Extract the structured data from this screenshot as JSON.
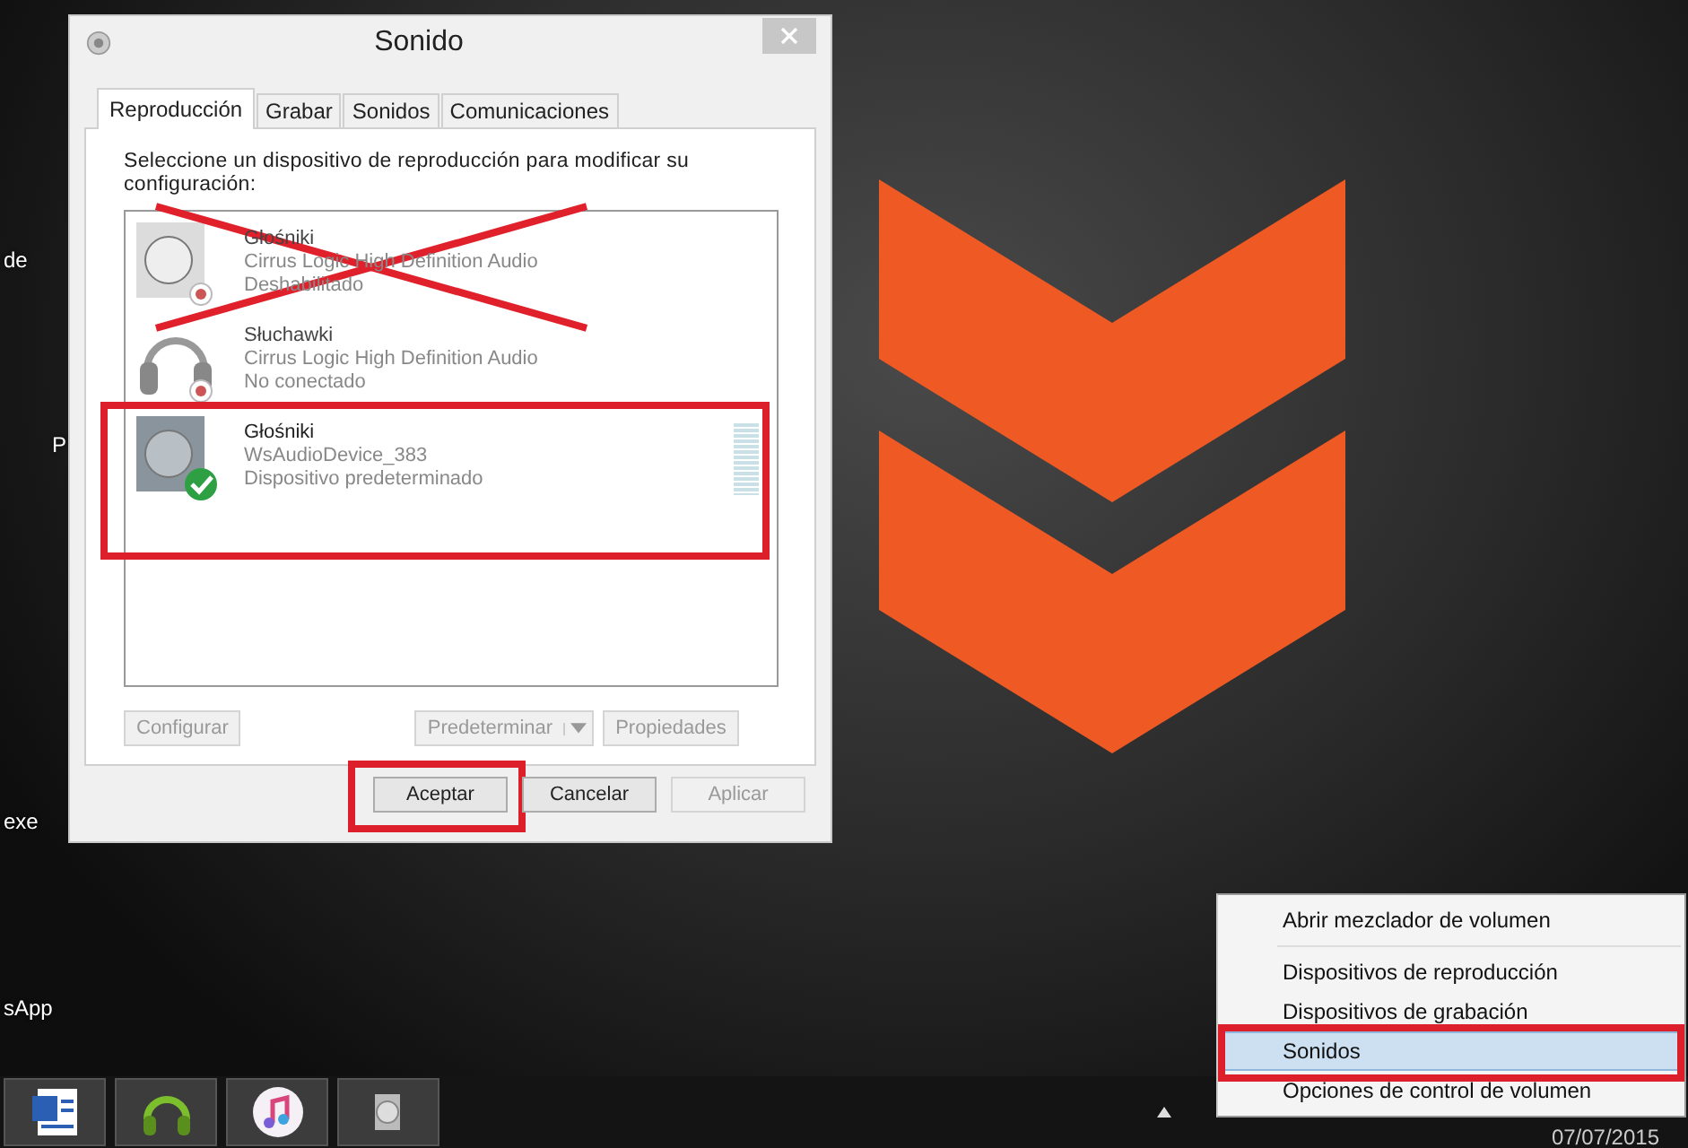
{
  "desktop": {
    "icon_labels": [
      {
        "label": "de"
      },
      {
        "label": "P"
      },
      {
        "label": "exe"
      },
      {
        "label": "sApp"
      }
    ]
  },
  "window": {
    "title": "Sonido",
    "tabs": [
      {
        "label": "Reproducción",
        "selected": true
      },
      {
        "label": "Grabar",
        "selected": false
      },
      {
        "label": "Sonidos",
        "selected": false
      },
      {
        "label": "Comunicaciones",
        "selected": false
      }
    ],
    "instruction": "Seleccione un dispositivo de reproducción para modificar su configuración:",
    "devices": [
      {
        "kind": "speaker",
        "name": "Głośniki",
        "driver": "Cirrus Logic High Definition Audio",
        "status": "Deshabilitado",
        "is_default": false,
        "dimmed": true,
        "crossed_out": true,
        "annotated": false
      },
      {
        "kind": "headphones",
        "name": "Słuchawki",
        "driver": "Cirrus Logic High Definition Audio",
        "status": "No conectado",
        "is_default": false,
        "dimmed": true,
        "crossed_out": false,
        "annotated": false
      },
      {
        "kind": "speaker",
        "name": "Głośniki",
        "driver": "WsAudioDevice_383",
        "status": "Dispositivo predeterminado",
        "is_default": true,
        "dimmed": false,
        "crossed_out": false,
        "annotated": true
      }
    ],
    "panel_buttons": [
      {
        "kind": "plain",
        "label": "Configurar",
        "disabled": true
      },
      {
        "kind": "split",
        "label": "Predeterminar",
        "disabled": true
      },
      {
        "kind": "plain",
        "label": "Propiedades",
        "disabled": true
      }
    ],
    "buttons": [
      {
        "label": "Aceptar",
        "disabled": false,
        "annotated": true
      },
      {
        "label": "Cancelar",
        "disabled": false,
        "annotated": false
      },
      {
        "label": "Aplicar",
        "disabled": true,
        "annotated": false
      }
    ]
  },
  "context_menu": {
    "items": [
      {
        "label": "Abrir mezclador de volumen",
        "selected": false,
        "annotated": false,
        "separator_after": true
      },
      {
        "label": "Dispositivos de reproducción",
        "selected": false,
        "annotated": false,
        "separator_after": false
      },
      {
        "label": "Dispositivos de grabación",
        "selected": false,
        "annotated": false,
        "separator_after": false
      },
      {
        "label": "Sonidos",
        "selected": true,
        "annotated": true,
        "separator_after": false
      },
      {
        "label": "Opciones de control de volumen",
        "selected": false,
        "annotated": false,
        "separator_after": false
      }
    ]
  },
  "taskbar": {
    "apps": [
      {
        "kind": "document"
      },
      {
        "kind": "headphones"
      },
      {
        "kind": "music"
      },
      {
        "kind": "speaker"
      }
    ],
    "date": "07/07/2015"
  }
}
